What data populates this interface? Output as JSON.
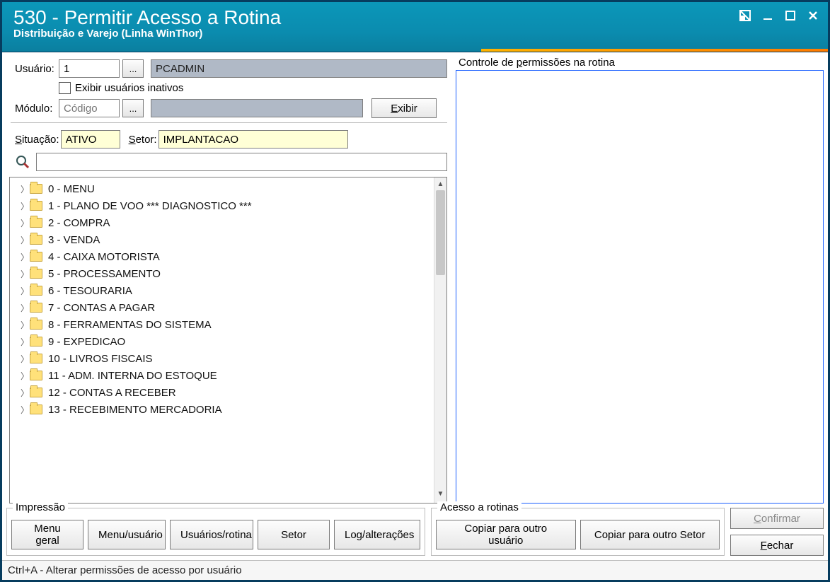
{
  "window": {
    "title": "530 - Permitir Acesso a Rotina",
    "subtitle": "Distribuição e Varejo (Linha WinThor)"
  },
  "form": {
    "usuario_label": "Usuário:",
    "usuario_codigo": "1",
    "usuario_nome": "PCADMIN",
    "exibir_inativos_label": "Exibir usuários inativos",
    "modulo_label": "Módulo:",
    "modulo_codigo_placeholder": "Código",
    "modulo_nome": "",
    "exibir_btn": "Exibir",
    "situacao_label": "Situação:",
    "situacao_value": "ATIVO",
    "setor_label": "Setor:",
    "setor_value": "IMPLANTACAO"
  },
  "tree": {
    "items": [
      "0 - MENU",
      "1 - PLANO DE VOO  *** DIAGNOSTICO ***",
      "2 - COMPRA",
      "3 - VENDA",
      "4 - CAIXA MOTORISTA",
      "5 - PROCESSAMENTO",
      "6 - TESOURARIA",
      "7 - CONTAS A PAGAR",
      "8 - FERRAMENTAS DO SISTEMA",
      "9 - EXPEDICAO",
      "10 - LIVROS FISCAIS",
      "11 - ADM. INTERNA DO ESTOQUE",
      "12 - CONTAS A RECEBER",
      "13 - RECEBIMENTO MERCADORIA"
    ]
  },
  "right_panel": {
    "title": "Controle de permissões na rotina"
  },
  "impressao": {
    "legend": "Impressão",
    "menu_geral": "Menu geral",
    "menu_usuario": "Menu/usuário",
    "usuarios_rotina": "Usuários/rotina",
    "setor": "Setor",
    "log": "Log/alterações"
  },
  "acesso": {
    "legend": "Acesso a rotinas",
    "copiar_usuario": "Copiar para outro usuário",
    "copiar_setor": "Copiar para outro Setor"
  },
  "actions": {
    "confirmar": "Confirmar",
    "fechar": "Fechar"
  },
  "statusbar": "Ctrl+A - Alterar permissões de acesso por usuário"
}
